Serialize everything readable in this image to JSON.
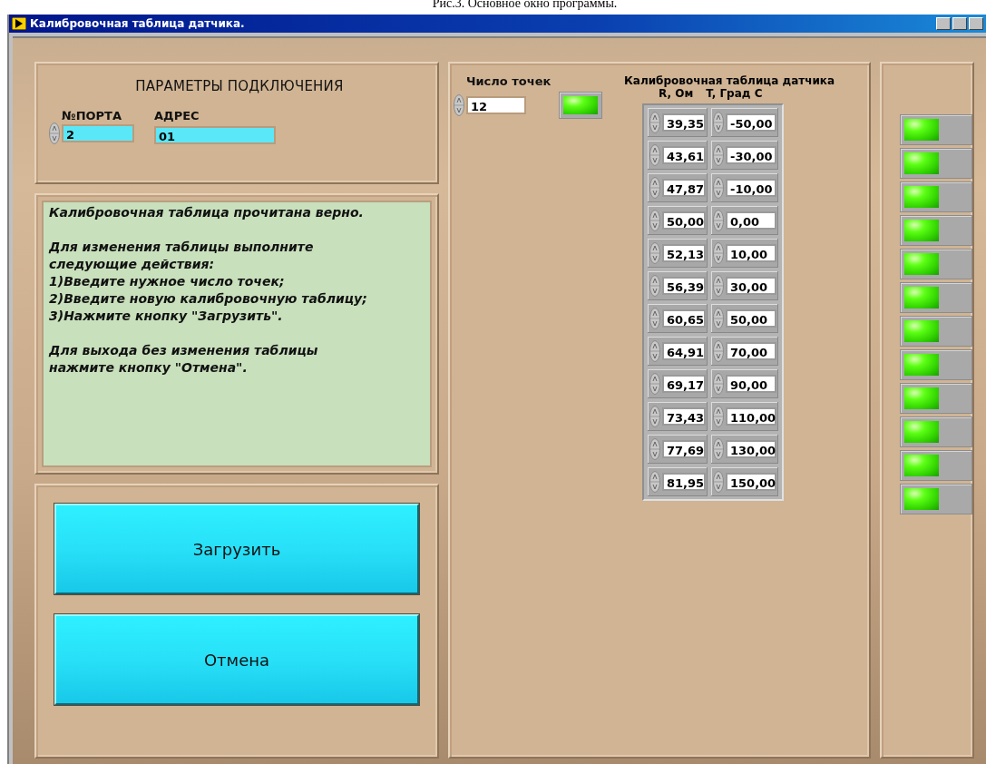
{
  "caption": "Рис.3. Основное окно программы.",
  "window": {
    "title": "Калибровочная таблица датчика."
  },
  "connection": {
    "title": "ПАРАМЕТРЫ ПОДКЛЮЧЕНИЯ",
    "port": {
      "label": "№ПОРТА",
      "value": "2"
    },
    "address": {
      "label": "АДРЕС",
      "value": "01"
    }
  },
  "message": [
    [
      "Калибровочная таблица прочитана верно."
    ],
    [
      "Для изменения таблицы выполните следующие действия:",
      "1)Введите нужное число точек;",
      "2)Введите новую калибровочную таблицу;",
      "3)Нажмите кнопку \"Загрузить\"."
    ],
    [
      "Для выхода без изменения таблицы нажмите кнопку \"Отмена\"."
    ]
  ],
  "buttons": [
    {
      "label": "Загрузить"
    },
    {
      "label": "Отмена"
    }
  ],
  "points": {
    "label": "Число точек",
    "value": "12",
    "indicator": {
      "on": true
    }
  },
  "table": {
    "title": "Калибровочная таблица датчика",
    "columns": [
      "R, Ом",
      "T, Град С"
    ],
    "rows": [
      [
        "39,35",
        "-50,00"
      ],
      [
        "43,61",
        "-30,00"
      ],
      [
        "47,87",
        "-10,00"
      ],
      [
        "50,00",
        "0,00"
      ],
      [
        "52,13",
        "10,00"
      ],
      [
        "56,39",
        "30,00"
      ],
      [
        "60,65",
        "50,00"
      ],
      [
        "64,91",
        "70,00"
      ],
      [
        "69,17",
        "90,00"
      ],
      [
        "73,43",
        "110,00"
      ],
      [
        "77,69",
        "130,00"
      ],
      [
        "81,95",
        "150,00"
      ]
    ]
  },
  "row_indicators": [
    {
      "on": true
    },
    {
      "on": true
    },
    {
      "on": true
    },
    {
      "on": true
    },
    {
      "on": true
    },
    {
      "on": true
    },
    {
      "on": true
    },
    {
      "on": true
    },
    {
      "on": true
    },
    {
      "on": true
    },
    {
      "on": true
    },
    {
      "on": true
    }
  ]
}
